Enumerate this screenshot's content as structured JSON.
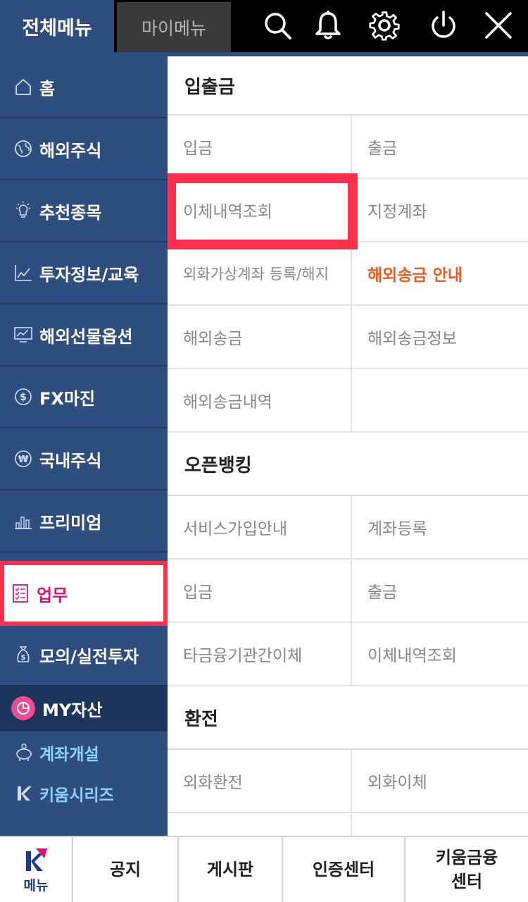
{
  "header": {
    "tab_all": "전체메뉴",
    "tab_my": "마이메뉴",
    "icons": [
      "search-icon",
      "bell-icon",
      "gear-icon",
      "power-icon",
      "close-icon"
    ]
  },
  "sidebar": {
    "items": [
      {
        "label": "홈",
        "icon": "home-icon"
      },
      {
        "label": "해외주식",
        "icon": "globe-icon"
      },
      {
        "label": "추천종목",
        "icon": "lightbulb-icon"
      },
      {
        "label": "투자정보/교육",
        "icon": "chart-line-icon"
      },
      {
        "label": "해외선물옵션",
        "icon": "monitor-chart-icon"
      },
      {
        "label": "FX마진",
        "icon": "dollar-icon"
      },
      {
        "label": "국내주식",
        "icon": "won-icon"
      },
      {
        "label": "프리미엄",
        "icon": "bar-chart-icon"
      },
      {
        "label": "업무",
        "icon": "checklist-icon"
      },
      {
        "label": "모의/실전투자",
        "icon": "money-bag-icon"
      }
    ],
    "active_index": 8,
    "my_asset": "MY자산",
    "links": [
      {
        "label": "계좌개설",
        "icon": "piggy-bank-icon"
      },
      {
        "label": "키움시리즈",
        "icon": "kiwoom-logo-icon"
      }
    ]
  },
  "content": {
    "sections": [
      {
        "title": "입출금",
        "rows": [
          [
            "입금",
            "출금"
          ],
          [
            "이체내역조회",
            "지정계좌"
          ],
          [
            "외화가상계좌 등록/해지",
            "해외송금 안내"
          ],
          [
            "해외송금",
            "해외송금정보"
          ],
          [
            "해외송금내역",
            ""
          ]
        ]
      },
      {
        "title": "오픈뱅킹",
        "rows": [
          [
            "서비스가입안내",
            "계좌등록"
          ],
          [
            "입금",
            "출금"
          ],
          [
            "타금융기관간이체",
            "이체내역조회"
          ]
        ]
      },
      {
        "title": "환전",
        "rows": [
          [
            "외화환전",
            "외화이체"
          ]
        ]
      }
    ],
    "highlight_color": "#ef5c1e"
  },
  "bottom_bar": {
    "menu_label": "메뉴",
    "items": [
      "공지",
      "게시판",
      "인증센터",
      "키움금융\n센터"
    ]
  },
  "colors": {
    "nav_blue": "#2d4e7e",
    "active_pink": "#e0107a",
    "highlight_red": "#ff2f4e",
    "link_blue": "#8fd3ff"
  }
}
